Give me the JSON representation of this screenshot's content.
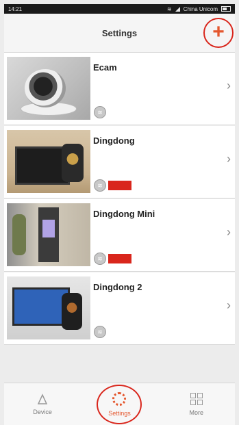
{
  "status_bar": {
    "time": "14:21",
    "carrier": "China Unicom"
  },
  "header": {
    "title": "Settings",
    "add_label": "+"
  },
  "devices": [
    {
      "name": "Ecam",
      "badge": ""
    },
    {
      "name": "Dingdong",
      "badge": ""
    },
    {
      "name": "Dingdong Mini",
      "badge": ""
    },
    {
      "name": "Dingdong 2",
      "badge": ""
    }
  ],
  "tabs": [
    {
      "label": "Device"
    },
    {
      "label": "Settings"
    },
    {
      "label": "More"
    }
  ],
  "colors": {
    "accent": "#e4572e",
    "highlight_ring": "#d9261c",
    "badge_red": "#d9261c"
  },
  "icons": [
    "signal-icon",
    "battery-icon",
    "plus-icon",
    "wifi-icon",
    "chevron-right-icon",
    "device-icon",
    "gear-icon",
    "grid-icon"
  ]
}
